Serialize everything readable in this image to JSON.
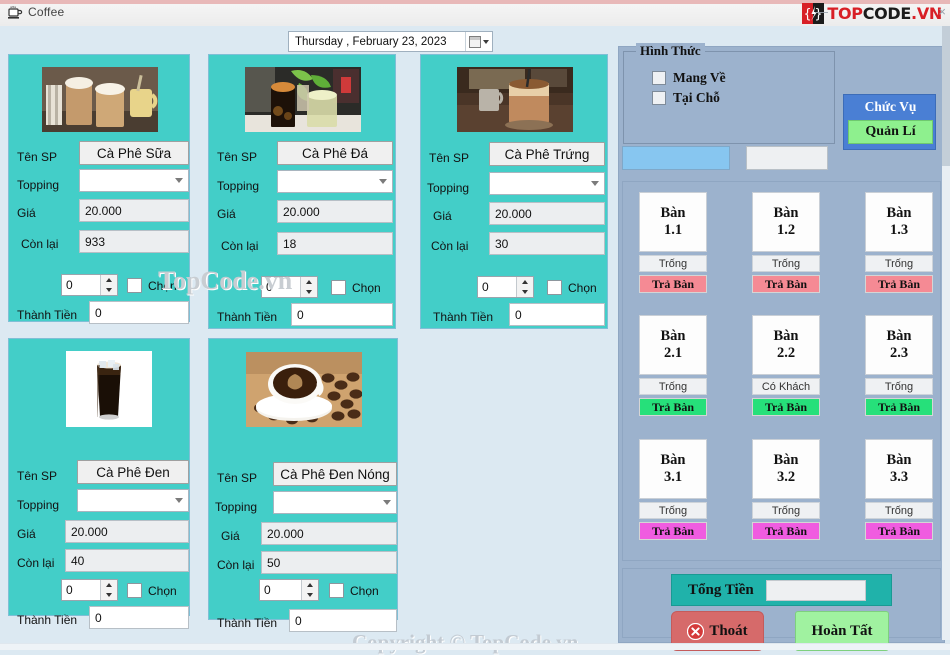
{
  "window": {
    "title": "Coffee",
    "app_icon": "coffee-cup-icon",
    "minimize": "—",
    "close": "×"
  },
  "brand": {
    "logo_top": "TOP",
    "logo_code": "CODE",
    "logo_vn": ".VN",
    "accent_red": "#d81f26",
    "watermark_center": "TopCode.vn",
    "watermark_bottom": "Copyright © TopCode.vn"
  },
  "date_picker": {
    "value": "Thursday ,  February  23, 2023",
    "dropdown_icon": "calendar-icon"
  },
  "labels": {
    "name": "Tên SP",
    "topping": "Topping",
    "price": "Giá",
    "remaining": "Còn lại",
    "total_line": "Thành Tiền",
    "select": "Chọn"
  },
  "products": [
    {
      "name": "Cà Phê Sữa",
      "topping": "",
      "price": "20.000",
      "remaining": "933",
      "quantity": "0",
      "line_total": "0",
      "image": "two-iced-latte-glasses"
    },
    {
      "name": "Cà Phê Đá",
      "topping": "",
      "price": "20.000",
      "remaining": "18",
      "quantity": "0",
      "line_total": "0",
      "image": "iced-black-coffee-and-lime-drink"
    },
    {
      "name": "Cà Phê Trứng",
      "topping": "",
      "price": "20.000",
      "remaining": "30",
      "quantity": "0",
      "line_total": "0",
      "image": "egg-coffee-glass"
    },
    {
      "name": "Cà Phê Đen",
      "topping": "",
      "price": "20.000",
      "remaining": "40",
      "quantity": "0",
      "line_total": "0",
      "image": "tall-black-iced-coffee"
    },
    {
      "name": "Cà Phê Đen Nóng",
      "topping": "",
      "price": "20.000",
      "remaining": "50",
      "quantity": "0",
      "line_total": "0",
      "image": "hot-black-coffee-cup-with-beans"
    }
  ],
  "service_type": {
    "group_title": "Hình Thức",
    "options": [
      {
        "label": "Mang Về",
        "checked": false
      },
      {
        "label": "Tại Chỗ",
        "checked": false
      }
    ],
    "field_blue_value": "",
    "field_grey_value": ""
  },
  "role": {
    "title": "Chức Vụ",
    "button_label": "Quản Lí",
    "button_color": "#8ef08e",
    "panel_color": "#4a7fd4"
  },
  "tables": [
    {
      "name": "Bàn",
      "number": "1.1",
      "status": "Trống",
      "action": "Trả Bàn",
      "action_color": "#f58a94"
    },
    {
      "name": "Bàn",
      "number": "1.2",
      "status": "Trống",
      "action": "Trả Bàn",
      "action_color": "#f58a94"
    },
    {
      "name": "Bàn",
      "number": "1.3",
      "status": "Trống",
      "action": "Trả Bàn",
      "action_color": "#f58a94"
    },
    {
      "name": "Bàn",
      "number": "2.1",
      "status": "Trống",
      "action": "Trả Bàn",
      "action_color": "#26e07a"
    },
    {
      "name": "Bàn",
      "number": "2.2",
      "status": "Có Khách",
      "action": "Trả Bàn",
      "action_color": "#26e07a"
    },
    {
      "name": "Bàn",
      "number": "2.3",
      "status": "Trống",
      "action": "Trả Bàn",
      "action_color": "#26e07a"
    },
    {
      "name": "Bàn",
      "number": "3.1",
      "status": "Trống",
      "action": "Trả Bàn",
      "action_color": "#f05ce0"
    },
    {
      "name": "Bàn",
      "number": "3.2",
      "status": "Trống",
      "action": "Trả Bàn",
      "action_color": "#f05ce0"
    },
    {
      "name": "Bàn",
      "number": "3.3",
      "status": "Trống",
      "action": "Trả Bàn",
      "action_color": "#f05ce0"
    }
  ],
  "footer": {
    "total_label": "Tổng Tiền",
    "total_value": "",
    "exit_label": "Thoát",
    "exit_icon": "close-circle-icon",
    "finish_label": "Hoàn Tất"
  }
}
